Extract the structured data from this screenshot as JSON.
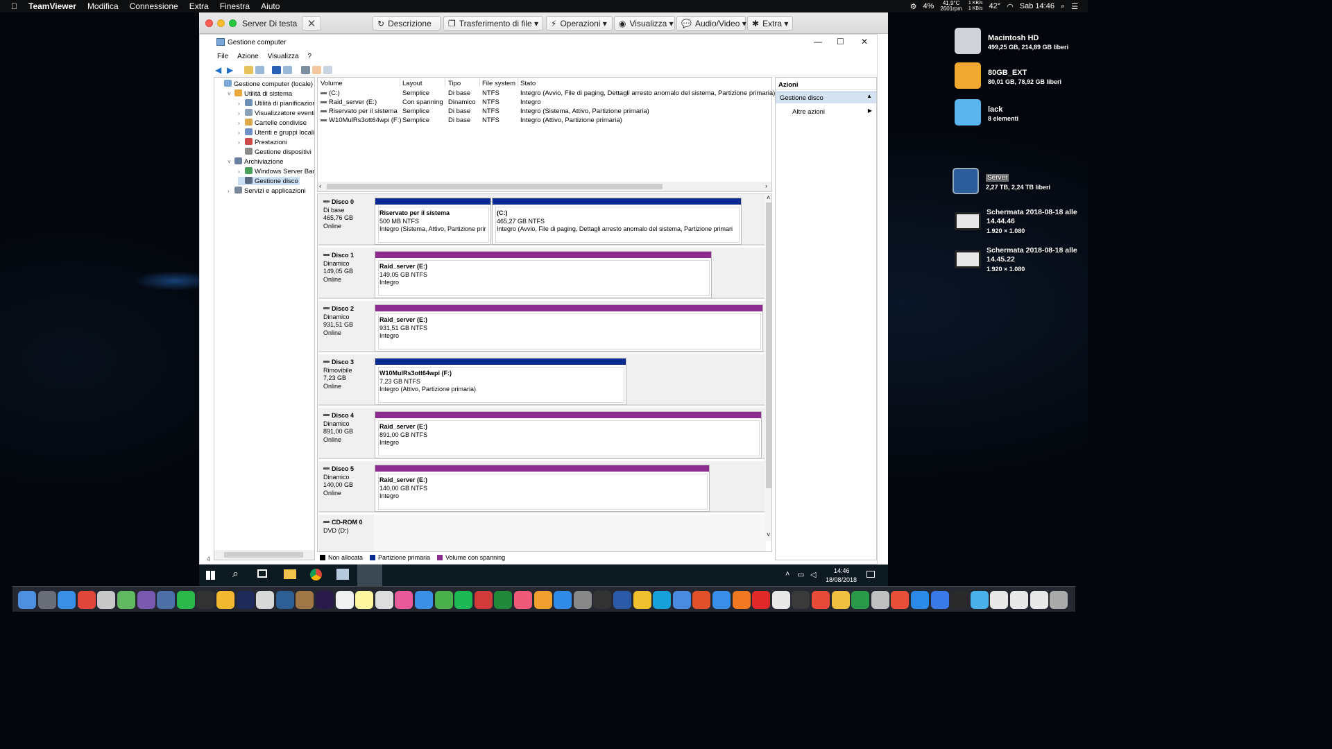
{
  "menubar": {
    "app": "TeamViewer",
    "items": [
      "Modifica",
      "Connessione",
      "Extra",
      "Finestra",
      "Aiuto"
    ],
    "battery": "4%",
    "temp": "41,9°C",
    "rpm": "2601rpm",
    "net_up": "1 KB/s",
    "net_down": "1 KB/s",
    "cpu_temp": "42°",
    "clock": "Sab 14:46"
  },
  "teamviewer": {
    "title": "Server Di testa",
    "buttons": [
      "Descrizione",
      "Trasferimento di file ▾",
      "Operazioni ▾",
      "Visualizza ▾",
      "Audio/Video ▾",
      "Extra ▾"
    ]
  },
  "app": {
    "title": "Gestione computer",
    "menu": [
      "File",
      "Azione",
      "Visualizza",
      "?"
    ]
  },
  "tree": [
    {
      "label": "Gestione computer (locale)",
      "level": 0,
      "arrow": ""
    },
    {
      "label": "Utilità di sistema",
      "level": 1,
      "arrow": "v"
    },
    {
      "label": "Utilità di pianificazione",
      "level": 2,
      "arrow": ">"
    },
    {
      "label": "Visualizzatore eventi",
      "level": 2,
      "arrow": ">"
    },
    {
      "label": "Cartelle condivise",
      "level": 2,
      "arrow": ">"
    },
    {
      "label": "Utenti e gruppi locali",
      "level": 2,
      "arrow": ">"
    },
    {
      "label": "Prestazioni",
      "level": 2,
      "arrow": ">"
    },
    {
      "label": "Gestione dispositivi",
      "level": 2,
      "arrow": ""
    },
    {
      "label": "Archiviazione",
      "level": 1,
      "arrow": "v"
    },
    {
      "label": "Windows Server Backup",
      "level": 2,
      "arrow": ">"
    },
    {
      "label": "Gestione disco",
      "level": 2,
      "arrow": "",
      "selected": true
    },
    {
      "label": "Servizi e applicazioni",
      "level": 1,
      "arrow": ">"
    }
  ],
  "volumes": {
    "headers": [
      "Volume",
      "Layout",
      "Tipo",
      "File system",
      "Stato"
    ],
    "rows": [
      [
        "(C:)",
        "Semplice",
        "Di base",
        "NTFS",
        "Integro (Avvio, File di paging, Dettagli arresto anomalo del sistema, Partizione primaria)"
      ],
      [
        "Raid_server (E:)",
        "Con spanning",
        "Dinamico",
        "NTFS",
        "Integro"
      ],
      [
        "Riservato per il sistema",
        "Semplice",
        "Di base",
        "NTFS",
        "Integro (Sistema, Attivo, Partizione primaria)"
      ],
      [
        "W10MulRs3ott64wpi (F:)",
        "Semplice",
        "Di base",
        "NTFS",
        "Integro (Attivo, Partizione primaria)"
      ]
    ]
  },
  "disks": [
    {
      "name": "Disco 0",
      "type": "Di base",
      "size": "465,76 GB",
      "status": "Online",
      "parts": [
        {
          "name": "Riservato per il sistema",
          "size": "500 MB NTFS",
          "state": "Integro (Sistema, Attivo, Partizione prir",
          "color": "#0b2a8f"
        },
        {
          "name": "(C:)",
          "size": "465,27 GB NTFS",
          "state": "Integro (Avvio, File di paging, Dettagli arresto anomalo del sistema, Partizione primari",
          "color": "#0b2a8f"
        }
      ]
    },
    {
      "name": "Disco 1",
      "type": "Dinamico",
      "size": "149,05 GB",
      "status": "Online",
      "parts": [
        {
          "name": "Raid_server  (E:)",
          "size": "149,05 GB NTFS",
          "state": "Integro",
          "color": "#8b2c8e"
        }
      ]
    },
    {
      "name": "Disco 2",
      "type": "Dinamico",
      "size": "931,51 GB",
      "status": "Online",
      "parts": [
        {
          "name": "Raid_server  (E:)",
          "size": "931,51 GB NTFS",
          "state": "Integro",
          "color": "#8b2c8e"
        }
      ]
    },
    {
      "name": "Disco 3",
      "type": "Rimovibile",
      "size": "7,23 GB",
      "status": "Online",
      "parts": [
        {
          "name": "W10MulRs3ott64wpi  (F:)",
          "size": "7,23 GB NTFS",
          "state": "Integro (Attivo, Partizione primaria)",
          "color": "#0b2a8f"
        }
      ]
    },
    {
      "name": "Disco 4",
      "type": "Dinamico",
      "size": "891,00 GB",
      "status": "Online",
      "parts": [
        {
          "name": "Raid_server  (E:)",
          "size": "891,00 GB NTFS",
          "state": "Integro",
          "color": "#8b2c8e"
        }
      ]
    },
    {
      "name": "Disco 5",
      "type": "Dinamico",
      "size": "140,00 GB",
      "status": "Online",
      "parts": [
        {
          "name": "Raid_server  (E:)",
          "size": "140,00 GB NTFS",
          "state": "Integro",
          "color": "#8b2c8e"
        }
      ]
    },
    {
      "name": "CD-ROM 0",
      "type": "DVD (D:)",
      "size": "",
      "status": "",
      "parts": []
    }
  ],
  "legend": [
    {
      "label": "Non allocata",
      "color": "#000000"
    },
    {
      "label": "Partizione primaria",
      "color": "#0b2a8f"
    },
    {
      "label": "Volume con spanning",
      "color": "#8b2c8e"
    }
  ],
  "actions": {
    "header": "Azioni",
    "section": "Gestione disco",
    "more": "Altre azioni"
  },
  "statusbar": "4",
  "taskbar": {
    "time": "14:46",
    "date": "18/08/2018"
  },
  "desktop": [
    {
      "name": "Macintosh HD",
      "sub": "499,25 GB, 214,89 GB liberi"
    },
    {
      "name": "80GB_EXT",
      "sub": "80,01 GB, 78,92 GB liberi"
    },
    {
      "name": "lack",
      "sub": "8 elementi"
    },
    {
      "name": "Server",
      "sub": "2,27 TB, 2,24 TB liberi"
    },
    {
      "name": "Schermata 2018-08-18 alle 14.44.46",
      "sub": "1.920 × 1.080"
    },
    {
      "name": "Schermata 2018-08-18 alle 14.45.22",
      "sub": "1.920 × 1.080"
    }
  ]
}
